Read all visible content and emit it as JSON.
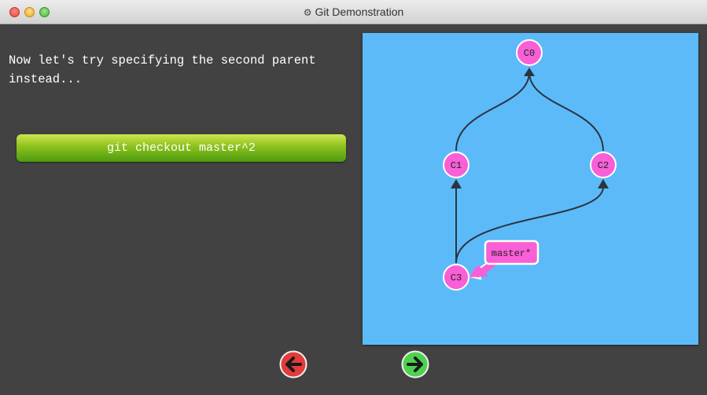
{
  "window": {
    "title": "Git Demonstration",
    "title_icon": "gear-icon"
  },
  "instruction": {
    "text": "Now let's try specifying the second parent instead..."
  },
  "command_button": {
    "label": "git checkout master^2"
  },
  "graph": {
    "commits": [
      {
        "id": "C0",
        "parents": []
      },
      {
        "id": "C1",
        "parents": [
          "C0"
        ]
      },
      {
        "id": "C2",
        "parents": [
          "C0"
        ]
      },
      {
        "id": "C3",
        "parents": [
          "C1",
          "C2"
        ]
      }
    ],
    "branches": [
      {
        "name": "master*",
        "target": "C3",
        "checked_out": true
      }
    ]
  },
  "navigation": {
    "prev_icon": "left-arrow-icon",
    "next_icon": "right-arrow-icon"
  },
  "colors": {
    "background": "#424242",
    "canvas": "#5cbaf9",
    "commit_fill": "#f95fd6",
    "branch_fill": "#f95fd6",
    "edge": "#2a3540",
    "button_green": "#8cc11c",
    "prev_button": "#e33b3b",
    "next_button": "#4ed24e"
  }
}
